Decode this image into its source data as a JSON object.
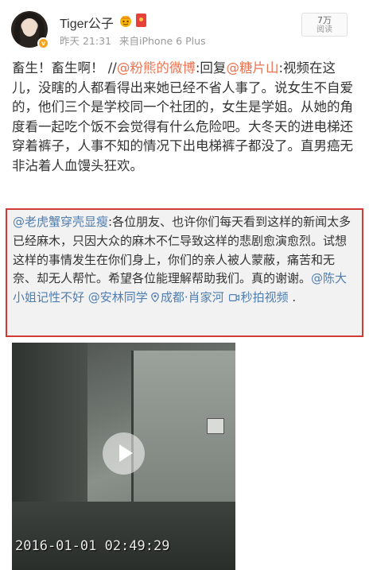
{
  "header": {
    "username": "Tiger公子",
    "time": "昨天 21:31",
    "source": "来自iPhone 6 Plus",
    "views_count": "7万",
    "views_label": "阅读"
  },
  "post": {
    "segments": [
      {
        "text": "畜生！畜生啊！ //",
        "style": "normal"
      },
      {
        "text": "@粉熊的微博",
        "style": "link"
      },
      {
        "text": ":回复",
        "style": "normal"
      },
      {
        "text": "@糖片山",
        "style": "link"
      },
      {
        "text": ":视频在这儿，没瞎的人都看得出来她已经不省人事了。说女生不自爱的，他们三个是学校同一个社团的，女生是学姐。从她的角度看一起吃个饭不会觉得有什么危险吧。大冬天的进电梯还穿着裤子，人事不知的情况下出电梯裤子都没了。直男癌无非沾着人血馒头狂欢。",
        "style": "normal"
      }
    ]
  },
  "quote": {
    "author": "@老虎蟹穿壳显瘦",
    "text": ":各位朋友、也许你们每天看到这样的新闻太多已经麻木，只因大众的麻木不仁导致这样的悲剧愈演愈烈。试想这样的事情发生在你们身上，你们的亲人被人蒙蔽，痛苦和无奈、却无人帮忙。希望各位能理解帮助我们。真的谢谢。",
    "mention1": "@陈大小姐记性不好",
    "mention2": "@安林同学",
    "location": "成都·肖家河",
    "video_label": "秒拍视频",
    "end": " ."
  },
  "video": {
    "timestamp": "2016-01-01 02:49:29"
  },
  "colors": {
    "link": "#eb7350",
    "blue_link": "#507daf",
    "highlight_border": "#d23a34"
  }
}
